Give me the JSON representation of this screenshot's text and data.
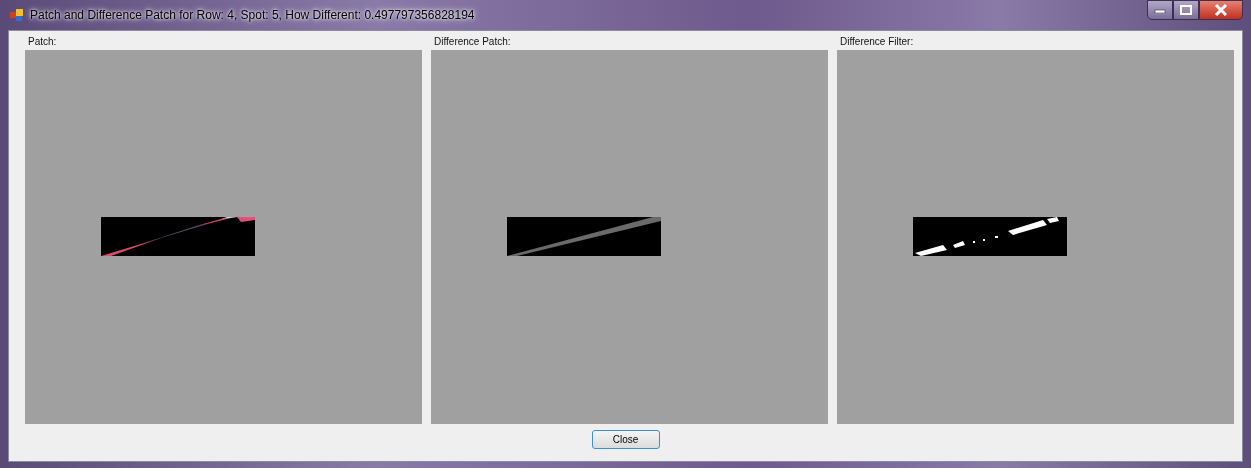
{
  "window": {
    "title": "Patch and Difference Patch for Row: 4, Spot: 5, How Different: 0.497797356828194"
  },
  "panels": [
    {
      "label": "Patch:",
      "kind": "patch"
    },
    {
      "label": "Difference Patch:",
      "kind": "difference"
    },
    {
      "label": "Difference Filter:",
      "kind": "filter"
    }
  ],
  "buttons": [
    "Close"
  ]
}
